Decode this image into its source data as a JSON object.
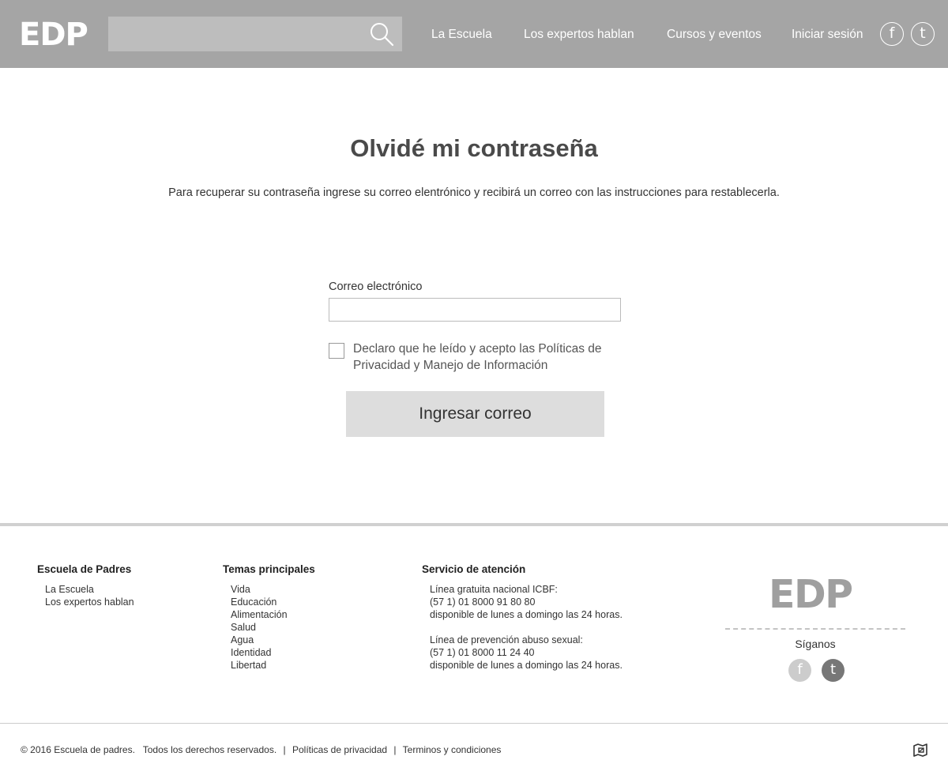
{
  "header": {
    "logo": "EDP",
    "search": {
      "placeholder": "",
      "value": ""
    },
    "nav": [
      {
        "label": "La Escuela"
      },
      {
        "label": "Los expertos hablan"
      },
      {
        "label": "Cursos y eventos"
      },
      {
        "label": "Iniciar sesión"
      }
    ],
    "social": {
      "facebook": "f",
      "twitter": "t"
    }
  },
  "main": {
    "title": "Olvidé mi contraseña",
    "subtitle": "Para recuperar su contraseña ingrese su correo elentrónico y recibirá un correo con las instrucciones para restablecerla.",
    "email_label": "Correo electrónico",
    "email_value": "",
    "checkbox_checked": false,
    "checkbox_label": "Declaro que he leído y acepto las Políticas de Privacidad y Manejo de Información",
    "submit_label": "Ingresar correo"
  },
  "footer": {
    "col1": {
      "title": "Escuela de Padres",
      "items": [
        "La Escuela",
        "Los expertos hablan"
      ]
    },
    "col2": {
      "title": "Temas principales",
      "items": [
        "Vida",
        "Educación",
        "Alimentación",
        "Salud",
        "Agua",
        "Identidad",
        "Libertad"
      ]
    },
    "col3": {
      "title": "Servicio de atención",
      "block1": [
        "Línea gratuita nacional ICBF:",
        "(57 1) 01 8000 91 80 80",
        "disponible de lunes a domingo las 24 horas."
      ],
      "block2": [
        "Línea de prevención abuso sexual:",
        "(57 1) 01 8000 11 24 40",
        "disponible de lunes a domingo las 24 horas."
      ]
    },
    "logo": "EDP",
    "follow_label": "Síganos",
    "social": {
      "facebook": "f",
      "twitter": "t"
    },
    "bottom": {
      "copyright": "© 2016 Escuela de padres.",
      "rights": "Todos los derechos reservados.",
      "privacy": "Políticas de privacidad",
      "terms": "Terminos y condiciones",
      "separator": "|"
    },
    "sitemap_icon": "sitemap-icon"
  },
  "colors": {
    "header_bg": "#a5a5a5",
    "search_bg": "#bdbdbd",
    "button_bg": "#dddddd",
    "title_color": "#4a4a4a",
    "footer_logo": "#9f9f9f"
  }
}
